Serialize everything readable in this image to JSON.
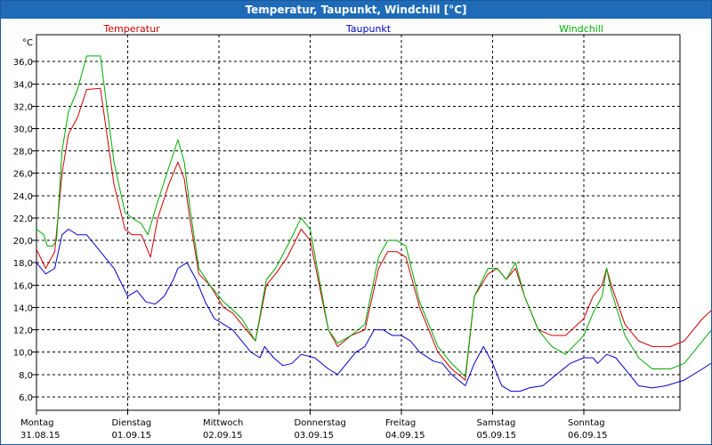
{
  "window": {
    "title": "Temperatur, Taupunkt, Windchill [°C]"
  },
  "chart_data": {
    "type": "line",
    "title": "Temperatur, Taupunkt, Windchill [°C]",
    "yunit": "°C",
    "ylim": [
      4.8,
      38.4
    ],
    "yticks": [
      6.0,
      8.0,
      10.0,
      12.0,
      14.0,
      16.0,
      18.0,
      20.0,
      22.0,
      24.0,
      26.0,
      28.0,
      30.0,
      32.0,
      34.0,
      36.0
    ],
    "ytick_labels": [
      "6,0",
      "8,0",
      "10,0",
      "12,0",
      "14,0",
      "16,0",
      "18,0",
      "20,0",
      "22,0",
      "24,0",
      "26,0",
      "28,0",
      "30,0",
      "32,0",
      "34,0",
      "36,0"
    ],
    "xlim": [
      0,
      7
    ],
    "xticks": [
      {
        "x": 0,
        "day": "Montag",
        "date": "31.08.15"
      },
      {
        "x": 1,
        "day": "Dienstag",
        "date": "01.09.15"
      },
      {
        "x": 2,
        "day": "Mittwoch",
        "date": "02.09.15"
      },
      {
        "x": 3,
        "day": "Donnerstag",
        "date": "03.09.15"
      },
      {
        "x": 4,
        "day": "Freitag",
        "date": "04.09.15"
      },
      {
        "x": 5,
        "day": "Samstag",
        "date": "05.09.15"
      },
      {
        "x": 6,
        "day": "Sonntag",
        "date": "06.09.15"
      }
    ],
    "grid": true,
    "legend": "top",
    "series": [
      {
        "name": "Temperatur",
        "color": "#cc0000",
        "points": [
          [
            0,
            19.2
          ],
          [
            0.1,
            17.5
          ],
          [
            0.2,
            19
          ],
          [
            0.28,
            26
          ],
          [
            0.35,
            29.5
          ],
          [
            0.45,
            31
          ],
          [
            0.55,
            33.5
          ],
          [
            0.7,
            33.6
          ],
          [
            0.85,
            25
          ],
          [
            0.97,
            21
          ],
          [
            1.05,
            20.5
          ],
          [
            1.15,
            20.5
          ],
          [
            1.25,
            18.5
          ],
          [
            1.33,
            22
          ],
          [
            1.45,
            25
          ],
          [
            1.55,
            27
          ],
          [
            1.62,
            25.5
          ],
          [
            1.68,
            22
          ],
          [
            1.78,
            17
          ],
          [
            1.9,
            16
          ],
          [
            2.05,
            14
          ],
          [
            2.15,
            13.5
          ],
          [
            2.25,
            12.5
          ],
          [
            2.4,
            11
          ],
          [
            2.52,
            16
          ],
          [
            2.62,
            17
          ],
          [
            2.75,
            18.5
          ],
          [
            2.9,
            21
          ],
          [
            3,
            20
          ],
          [
            3.2,
            12
          ],
          [
            3.3,
            10.5
          ],
          [
            3.45,
            11.5
          ],
          [
            3.6,
            12
          ],
          [
            3.75,
            17.5
          ],
          [
            3.85,
            19
          ],
          [
            3.95,
            19
          ],
          [
            4.05,
            18.5
          ],
          [
            4.2,
            14
          ],
          [
            4.4,
            10
          ],
          [
            4.55,
            8.5
          ],
          [
            4.7,
            7.5
          ],
          [
            4.8,
            15
          ],
          [
            4.95,
            17
          ],
          [
            5.05,
            17.5
          ],
          [
            5.15,
            16.5
          ],
          [
            5.25,
            17.5
          ],
          [
            5.35,
            15
          ],
          [
            5.5,
            12
          ],
          [
            5.65,
            11.5
          ],
          [
            5.8,
            11.5
          ],
          [
            6,
            13
          ],
          [
            6.1,
            15
          ],
          [
            6.2,
            16
          ],
          [
            6.25,
            17.5
          ],
          [
            6.3,
            16
          ],
          [
            6.45,
            12.5
          ],
          [
            6.6,
            11
          ],
          [
            6.75,
            10.5
          ],
          [
            6.95,
            10.5
          ],
          [
            7.1,
            11
          ],
          [
            7.3,
            13
          ],
          [
            7.5,
            14.5
          ],
          [
            7.6,
            14.8
          ],
          [
            7.7,
            13
          ],
          [
            7.8,
            11
          ],
          [
            7.9,
            11
          ],
          [
            8,
            11
          ]
        ]
      },
      {
        "name": "Taupunkt",
        "color": "#0000cc",
        "points": [
          [
            0,
            18
          ],
          [
            0.1,
            17
          ],
          [
            0.2,
            17.5
          ],
          [
            0.28,
            20.5
          ],
          [
            0.35,
            21
          ],
          [
            0.45,
            20.5
          ],
          [
            0.55,
            20.5
          ],
          [
            0.7,
            19
          ],
          [
            0.85,
            17.5
          ],
          [
            1,
            15
          ],
          [
            1.1,
            15.5
          ],
          [
            1.2,
            14.5
          ],
          [
            1.3,
            14.3
          ],
          [
            1.4,
            15
          ],
          [
            1.5,
            16.5
          ],
          [
            1.55,
            17.5
          ],
          [
            1.65,
            18
          ],
          [
            1.75,
            16.5
          ],
          [
            1.85,
            14.5
          ],
          [
            1.95,
            13
          ],
          [
            2.05,
            12.5
          ],
          [
            2.15,
            12
          ],
          [
            2.25,
            11
          ],
          [
            2.35,
            10
          ],
          [
            2.45,
            9.5
          ],
          [
            2.5,
            10.5
          ],
          [
            2.6,
            9.5
          ],
          [
            2.7,
            8.8
          ],
          [
            2.8,
            9
          ],
          [
            2.9,
            9.8
          ],
          [
            3.05,
            9.5
          ],
          [
            3.2,
            8.5
          ],
          [
            3.3,
            8
          ],
          [
            3.4,
            9
          ],
          [
            3.5,
            10
          ],
          [
            3.6,
            10.5
          ],
          [
            3.7,
            12
          ],
          [
            3.8,
            12
          ],
          [
            3.9,
            11.5
          ],
          [
            4,
            11.5
          ],
          [
            4.1,
            11
          ],
          [
            4.2,
            10
          ],
          [
            4.35,
            9.2
          ],
          [
            4.45,
            9
          ],
          [
            4.55,
            8
          ],
          [
            4.7,
            7
          ],
          [
            4.8,
            9
          ],
          [
            4.9,
            10.5
          ],
          [
            5,
            9
          ],
          [
            5.1,
            7
          ],
          [
            5.2,
            6.5
          ],
          [
            5.3,
            6.5
          ],
          [
            5.4,
            6.8
          ],
          [
            5.55,
            7
          ],
          [
            5.7,
            8
          ],
          [
            5.85,
            9
          ],
          [
            6,
            9.5
          ],
          [
            6.1,
            9.5
          ],
          [
            6.15,
            9
          ],
          [
            6.25,
            9.8
          ],
          [
            6.35,
            9.5
          ],
          [
            6.5,
            8
          ],
          [
            6.6,
            7
          ],
          [
            6.75,
            6.8
          ],
          [
            6.9,
            7
          ],
          [
            7.1,
            7.5
          ],
          [
            7.3,
            8.5
          ],
          [
            7.45,
            9.3
          ],
          [
            7.6,
            9.5
          ],
          [
            7.7,
            9.8
          ],
          [
            7.8,
            8.5
          ],
          [
            7.9,
            8
          ],
          [
            8,
            8
          ]
        ]
      },
      {
        "name": "Windchill",
        "color": "#00aa00",
        "points": [
          [
            0,
            21
          ],
          [
            0.08,
            20.5
          ],
          [
            0.12,
            19.5
          ],
          [
            0.18,
            19.5
          ],
          [
            0.22,
            20
          ],
          [
            0.28,
            28
          ],
          [
            0.35,
            31.5
          ],
          [
            0.45,
            33.5
          ],
          [
            0.55,
            36.5
          ],
          [
            0.7,
            36.5
          ],
          [
            0.85,
            27
          ],
          [
            0.97,
            22.5
          ],
          [
            1.05,
            22
          ],
          [
            1.15,
            21.5
          ],
          [
            1.22,
            20.5
          ],
          [
            1.33,
            23.5
          ],
          [
            1.45,
            26.5
          ],
          [
            1.55,
            29
          ],
          [
            1.62,
            27
          ],
          [
            1.68,
            23
          ],
          [
            1.78,
            17.5
          ],
          [
            1.9,
            16
          ],
          [
            2.05,
            14.5
          ],
          [
            2.15,
            13.8
          ],
          [
            2.25,
            13
          ],
          [
            2.4,
            11
          ],
          [
            2.52,
            16.5
          ],
          [
            2.62,
            17.5
          ],
          [
            2.75,
            19.5
          ],
          [
            2.9,
            22
          ],
          [
            3,
            21
          ],
          [
            3.2,
            12
          ],
          [
            3.3,
            10.8
          ],
          [
            3.45,
            11.5
          ],
          [
            3.6,
            12.5
          ],
          [
            3.75,
            18.5
          ],
          [
            3.85,
            20
          ],
          [
            3.95,
            20
          ],
          [
            4.05,
            19.5
          ],
          [
            4.2,
            14.5
          ],
          [
            4.4,
            10.5
          ],
          [
            4.55,
            9
          ],
          [
            4.7,
            7.8
          ],
          [
            4.8,
            15
          ],
          [
            4.95,
            17.5
          ],
          [
            5.05,
            17.5
          ],
          [
            5.15,
            16.5
          ],
          [
            5.25,
            18
          ],
          [
            5.35,
            15
          ],
          [
            5.5,
            12
          ],
          [
            5.65,
            10.5
          ],
          [
            5.8,
            9.8
          ],
          [
            6,
            11.5
          ],
          [
            6.1,
            13.5
          ],
          [
            6.2,
            15
          ],
          [
            6.25,
            17.5
          ],
          [
            6.3,
            15.5
          ],
          [
            6.45,
            11.5
          ],
          [
            6.6,
            9.5
          ],
          [
            6.75,
            8.5
          ],
          [
            6.95,
            8.5
          ],
          [
            7.1,
            9
          ],
          [
            7.3,
            11
          ],
          [
            7.5,
            13
          ],
          [
            7.6,
            13.5
          ],
          [
            7.7,
            11
          ],
          [
            7.8,
            9.5
          ],
          [
            7.9,
            9.5
          ],
          [
            8,
            9.8
          ]
        ]
      }
    ]
  }
}
